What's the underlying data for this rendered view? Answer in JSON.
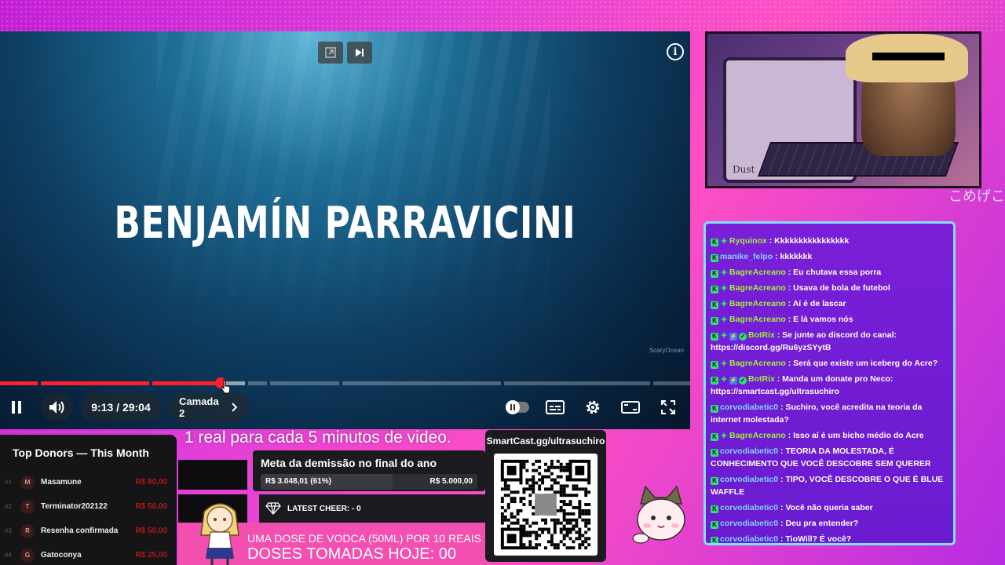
{
  "player": {
    "video_title": "BENJAMÍN PARRAVICINI",
    "watermark": "ScaryOcean",
    "time_display": "9:13 / 29:04",
    "chapter_label": "Camada 2",
    "progress_fraction": 0.317,
    "accent_color": "#ff1f2e"
  },
  "chat": {
    "messages": [
      {
        "user": "Ryquinox",
        "text": ": Kkkkkkkkkkkkkkkk"
      },
      {
        "user": "manike_felpo",
        "text": ": kkkkkkk"
      },
      {
        "user": "BagreAcreano",
        "text": ": Eu chutava essa porra"
      },
      {
        "user": "BagreAcreano",
        "text": ": Usava de bola de futebol"
      },
      {
        "user": "BagreAcreano",
        "text": ": Aí é de lascar"
      },
      {
        "user": "BagreAcreano",
        "text": ": E lá vamos nós"
      },
      {
        "user": "BotRix",
        "text": ": Se junte ao discord do canal: https://discord.gg/Ru6yzSYytB"
      },
      {
        "user": "BagreAcreano",
        "text": ": Será que existe um iceberg do Acre?"
      },
      {
        "user": "BotRix",
        "text": ": Manda um donate pro Neco: https://smartcast.gg/ultrasuchiro"
      },
      {
        "user": "corvodiabetic0",
        "text": ": Suchiro, você acredita na teoria da internet molestada?"
      },
      {
        "user": "BagreAcreano",
        "text": ": Isso aí é um bicho médio do Acre"
      },
      {
        "user": "corvodiabetic0",
        "text": ": TEORIA DA MOLESTADA, É CONHECIMENTO QUE VOCÊ DESCOBRE SEM QUERER"
      },
      {
        "user": "corvodiabetic0",
        "text": ": TIPO, VOCÊ DESCOBRE O QUE É BLUE WAFFLE"
      },
      {
        "user": "corvodiabetic0",
        "text": ": Você não queria saber"
      },
      {
        "user": "corvodiabetic0",
        "text": ": Deu pra entender?"
      },
      {
        "user": "corvodiabetic0",
        "text": ": TioWill? É você?"
      }
    ]
  },
  "donors": {
    "title": "Top Donors — This Month",
    "list": [
      {
        "rank": "#1",
        "initial": "M",
        "name": "Masamune",
        "amount": "R$ 80,00"
      },
      {
        "rank": "#2",
        "initial": "T",
        "name": "Terminator202122",
        "amount": "R$ 50,00"
      },
      {
        "rank": "#3",
        "initial": "R",
        "name": "Resenha confirmada",
        "amount": "R$ 50,00"
      },
      {
        "rank": "#4",
        "initial": "G",
        "name": "Gatoconya",
        "amount": "R$ 25,00"
      }
    ]
  },
  "overlay": {
    "caption_top": "1 real para cada 5 minutos de video.",
    "goal_title": "Meta da demissão no final do ano",
    "goal_current": "R$ 3.048,01 (61%)",
    "goal_target": "R$ 5.000,00",
    "goal_fraction": 0.61,
    "latest_cheer": "LATEST CHEER: - 0",
    "qr_label": "SmartCast.gg/ultrasuchiro",
    "vodka_line1": "UMA DOSE DE VODCA (50ML) POR 10 REAIS",
    "vodka_line2": "DOSES TOMADAS HOJE: 00"
  },
  "cam": {
    "side_text": "こめげこ",
    "monitor_sticker": "Dust"
  }
}
